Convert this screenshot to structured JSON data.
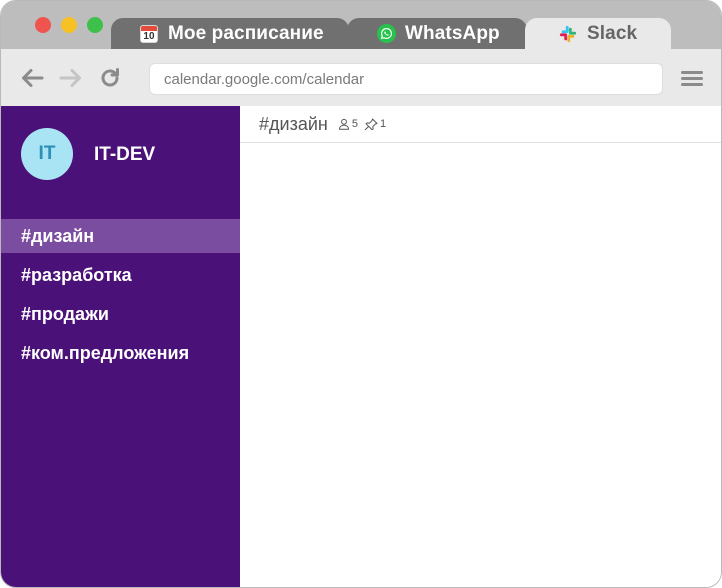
{
  "browser": {
    "tabs": [
      {
        "label": "Мое расписание",
        "icon": "calendar-icon",
        "icon_text": "10",
        "active": false
      },
      {
        "label": "WhatsApp",
        "icon": "whatsapp-icon",
        "active": false
      },
      {
        "label": "Slack",
        "icon": "slack-icon",
        "active": true
      }
    ],
    "url": "calendar.google.com/calendar",
    "nav_icons": [
      "back-arrow-icon",
      "forward-arrow-icon",
      "reload-icon",
      "hamburger-menu-icon"
    ]
  },
  "workspace": {
    "avatar_text": "IT",
    "name": "IT-DEV",
    "avatar_color": "#a9e4f5",
    "sidebar_color": "#4a1278",
    "active_color": "#7a4da0"
  },
  "channels": [
    {
      "label": "#дизайн",
      "active": true
    },
    {
      "label": "#разработка",
      "active": false
    },
    {
      "label": "#продажи",
      "active": false
    },
    {
      "label": "#ком.предложения",
      "active": false
    }
  ],
  "channel_header": {
    "title": "#дизайн",
    "members_count": "5",
    "pinned_count": "1"
  }
}
